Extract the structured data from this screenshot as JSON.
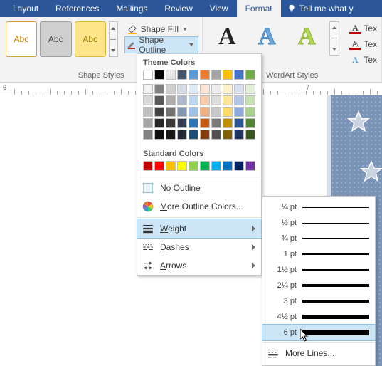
{
  "tabs": {
    "items": [
      "Layout",
      "References",
      "Mailings",
      "Review",
      "View",
      "Format"
    ],
    "active": "Format",
    "tell_me": "Tell me what y"
  },
  "ribbon": {
    "shape_styles": {
      "label": "Shape Styles",
      "previews": [
        "Abc",
        "Abc",
        "Abc"
      ],
      "shape_fill": "Shape Fill",
      "shape_outline": "Shape Outline"
    },
    "wordart": {
      "label": "WordArt Styles",
      "glyph": "A",
      "text_fill": "Tex",
      "text_outline": "Tex",
      "text_effects": "Tex"
    }
  },
  "ruler": {
    "numbers": [
      "6",
      "7"
    ]
  },
  "outline_menu": {
    "theme_header": "Theme Colors",
    "theme_top": [
      "#ffffff",
      "#000000",
      "#e7e6e6",
      "#44546a",
      "#5b9bd5",
      "#ed7d31",
      "#a5a5a5",
      "#ffc000",
      "#4472c4",
      "#70ad47"
    ],
    "theme_shades": [
      [
        "#f2f2f2",
        "#d9d9d9",
        "#bfbfbf",
        "#a6a6a6",
        "#808080"
      ],
      [
        "#808080",
        "#595959",
        "#404040",
        "#262626",
        "#0d0d0d"
      ],
      [
        "#d0cece",
        "#aeabab",
        "#757070",
        "#3b3838",
        "#171616"
      ],
      [
        "#d6dce5",
        "#adb9ca",
        "#8497b0",
        "#333f50",
        "#222a35"
      ],
      [
        "#deebf7",
        "#bdd7ee",
        "#9dc3e6",
        "#2e75b6",
        "#1f4e79"
      ],
      [
        "#fbe5d6",
        "#f8cbad",
        "#f4b183",
        "#c55a11",
        "#843c0c"
      ],
      [
        "#ededed",
        "#dbdbdb",
        "#c9c9c9",
        "#7b7b7b",
        "#525252"
      ],
      [
        "#fff2cc",
        "#ffe699",
        "#ffd966",
        "#bf9000",
        "#806000"
      ],
      [
        "#d9e2f3",
        "#b4c7e7",
        "#8faadc",
        "#2f5597",
        "#203864"
      ],
      [
        "#e2f0d9",
        "#c5e0b4",
        "#a9d18e",
        "#548235",
        "#385723"
      ]
    ],
    "standard_header": "Standard Colors",
    "standard": [
      "#c00000",
      "#ff0000",
      "#ffc000",
      "#ffff00",
      "#92d050",
      "#00b050",
      "#00b0f0",
      "#0070c0",
      "#002060",
      "#7030a0"
    ],
    "no_outline": "No Outline",
    "more_colors": "More Outline Colors...",
    "weight": "Weight",
    "dashes": "Dashes",
    "arrows": "Arrows"
  },
  "weight_menu": {
    "items": [
      {
        "label": "¼ pt",
        "px": 1
      },
      {
        "label": "½ pt",
        "px": 1
      },
      {
        "label": "¾ pt",
        "px": 1.5
      },
      {
        "label": "1 pt",
        "px": 2
      },
      {
        "label": "1½ pt",
        "px": 2.5
      },
      {
        "label": "2¼ pt",
        "px": 3.5
      },
      {
        "label": "3 pt",
        "px": 4.5
      },
      {
        "label": "4½ pt",
        "px": 6
      },
      {
        "label": "6 pt",
        "px": 8
      }
    ],
    "hover_index": 8,
    "more_lines": "More Lines..."
  }
}
